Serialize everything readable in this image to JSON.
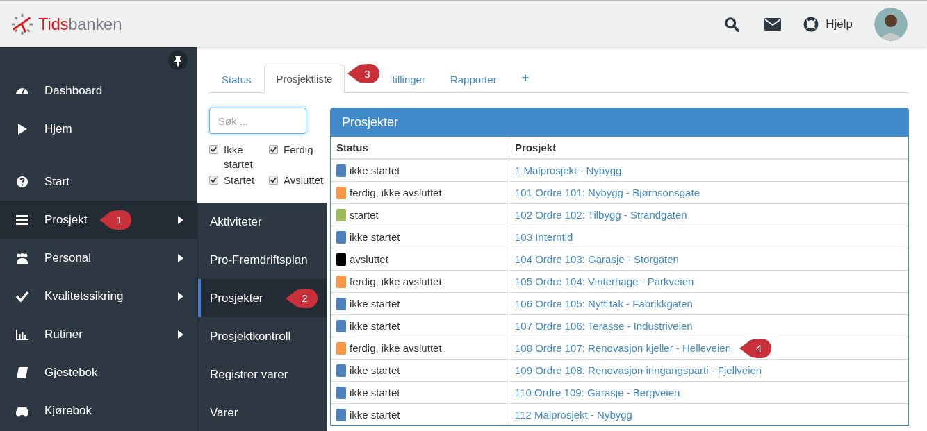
{
  "header": {
    "logo": {
      "first": "Tids",
      "second": "banken"
    },
    "help": "Hjelp"
  },
  "sidebar": {
    "groups": [
      [
        {
          "label": "Dashboard",
          "kind": "gauge",
          "submenu": false,
          "selected": false
        },
        {
          "label": "Hjem",
          "kind": "play",
          "submenu": false,
          "selected": false
        }
      ],
      [
        {
          "label": "Start",
          "kind": "question",
          "submenu": false,
          "selected": false
        },
        {
          "label": "Prosjekt",
          "kind": "list",
          "submenu": true,
          "selected": true,
          "callout": "1"
        },
        {
          "label": "Personal",
          "kind": "users",
          "submenu": true,
          "selected": false
        },
        {
          "label": "Kvalitetssikring",
          "kind": "check",
          "submenu": true,
          "selected": false
        },
        {
          "label": "Rutiner",
          "kind": "chart",
          "submenu": true,
          "selected": false
        },
        {
          "label": "Gjestebok",
          "kind": "book",
          "submenu": false,
          "selected": false
        },
        {
          "label": "Kjørebok",
          "kind": "car",
          "submenu": false,
          "selected": false
        }
      ]
    ]
  },
  "submenu": {
    "items": [
      {
        "label": "Aktiviteter",
        "selected": false
      },
      {
        "label": "Pro-Fremdriftsplan",
        "selected": false
      },
      {
        "label": "Prosjekter",
        "selected": true,
        "callout": "2"
      },
      {
        "label": "Prosjektkontroll",
        "selected": false
      },
      {
        "label": "Registrer varer",
        "selected": false
      },
      {
        "label": "Varer",
        "selected": false
      }
    ]
  },
  "tabs": [
    {
      "label": "Status",
      "selected": false,
      "kind": "text"
    },
    {
      "label": "Prosjektliste",
      "selected": true,
      "kind": "text",
      "callout": "3"
    },
    {
      "label": "tillinger",
      "selected": false,
      "kind": "text"
    },
    {
      "label": "Rapporter",
      "selected": false,
      "kind": "text"
    },
    {
      "label": "+",
      "selected": false,
      "kind": "add"
    }
  ],
  "filters": {
    "search": {
      "placeholder": "Søk ..."
    },
    "checkboxes": [
      {
        "label": "Ikke startet",
        "checked": true
      },
      {
        "label": "Startet",
        "checked": true
      },
      {
        "label": "Ferdig",
        "checked": true
      },
      {
        "label": "Avsluttet",
        "checked": true
      }
    ]
  },
  "panel": {
    "title": "Prosjekter",
    "columns": [
      "Status",
      "Prosjekt"
    ],
    "rows": [
      {
        "status": "ikke startet",
        "color": "#4f81bd",
        "project": "1 Malprosjekt - Nybygg"
      },
      {
        "status": "ferdig, ikke avsluttet",
        "color": "#f79646",
        "project": "101 Ordre 101: Nybygg - Bjørnsonsgate"
      },
      {
        "status": "startet",
        "color": "#9bbb59",
        "project": "102 Ordre 102: Tilbygg - Strandgaten"
      },
      {
        "status": "ikke startet",
        "color": "#4f81bd",
        "project": "103 Interntid"
      },
      {
        "status": "avsluttet",
        "color": "#000000",
        "project": "104 Ordre 103: Garasje - Storgaten"
      },
      {
        "status": "ferdig, ikke avsluttet",
        "color": "#f79646",
        "project": "105 Ordre 104: Vinterhage - Parkveien"
      },
      {
        "status": "ikke startet",
        "color": "#4f81bd",
        "project": "106 Ordre 105: Nytt tak - Fabrikkgaten"
      },
      {
        "status": "ikke startet",
        "color": "#4f81bd",
        "project": "107 Ordre 106: Terasse - Industriveien"
      },
      {
        "status": "ferdig, ikke avsluttet",
        "color": "#f79646",
        "project": "108 Ordre 107: Renovasjon kjeller - Helleveien",
        "callout": "4"
      },
      {
        "status": "ikke startet",
        "color": "#4f81bd",
        "project": "109 Ordre 108: Renovasjon inngangsparti - Fjellveien"
      },
      {
        "status": "ikke startet",
        "color": "#4f81bd",
        "project": "110 Ordre 109: Garasje - Bergveien"
      },
      {
        "status": "ikke startet",
        "color": "#4f81bd",
        "project": "112 Malprosjekt - Nybygg"
      }
    ]
  }
}
